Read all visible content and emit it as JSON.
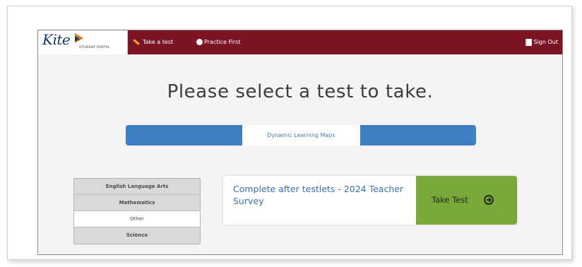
{
  "header": {
    "logo_word": "Kite",
    "logo_sub": "STUDENT PORTAL",
    "nav": {
      "take_test": "Take a test",
      "practice_first": "Practice First",
      "sign_out": "Sign Out"
    },
    "color": "#7c1423"
  },
  "main": {
    "title": "Please select a test to take.",
    "tabs": [
      {
        "label": "",
        "active": false
      },
      {
        "label": "Dynamic Learning Maps",
        "active": true
      },
      {
        "label": "",
        "active": false
      }
    ],
    "tab_color": "#3d7fc1",
    "subjects": [
      {
        "label": "English Language Arts",
        "selected": false
      },
      {
        "label": "Mathematics",
        "selected": false
      },
      {
        "label": "Other",
        "selected": true
      },
      {
        "label": "Science",
        "selected": false
      }
    ],
    "test": {
      "name": "Complete after testlets - 2024 Teacher Survey",
      "button_label": "Take Test",
      "button_color": "#7aa83a"
    }
  },
  "icons": {
    "take_test_nav": "pencil-icon",
    "practice_nav": "circle-icon",
    "sign_out_nav": "door-icon",
    "take_test_button": "arrow-circle-right-icon"
  }
}
